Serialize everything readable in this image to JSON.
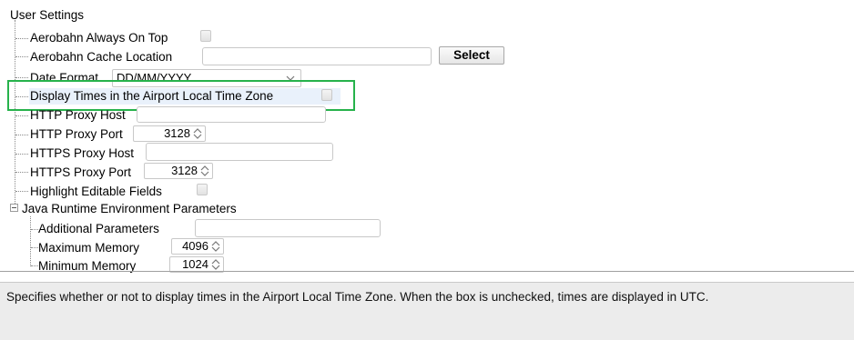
{
  "tree": {
    "root_label": "User Settings",
    "items": [
      {
        "label": "Aerobahn Always On Top"
      },
      {
        "label": "Aerobahn Cache Location",
        "value": "",
        "button": "Select"
      },
      {
        "label": "Date Format",
        "value": "DD/MM/YYYY"
      },
      {
        "label": "Display Times in the Airport Local Time Zone"
      },
      {
        "label": "HTTP Proxy Host",
        "value": ""
      },
      {
        "label": "HTTP Proxy Port",
        "value": "3128"
      },
      {
        "label": "HTTPS Proxy Host",
        "value": ""
      },
      {
        "label": "HTTPS Proxy Port",
        "value": "3128"
      },
      {
        "label": "Highlight Editable Fields"
      },
      {
        "label": "Java Runtime Environment Parameters"
      }
    ],
    "jre_items": [
      {
        "label": "Additional Parameters",
        "value": ""
      },
      {
        "label": "Maximum Memory",
        "value": "4096"
      },
      {
        "label": "Minimum Memory",
        "value": "1024"
      }
    ]
  },
  "description": "Specifies whether or not to display times in the Airport Local Time Zone.  When the box is unchecked, times are displayed in UTC.",
  "colors": {
    "highlight_box": "#26b24b",
    "selection": "#e9f1fb",
    "description_bg": "#ececec"
  },
  "icons": [
    "checkbox-icon",
    "spinner-arrows-icon",
    "dropdown-arrow-icon",
    "collapse-icon"
  ]
}
